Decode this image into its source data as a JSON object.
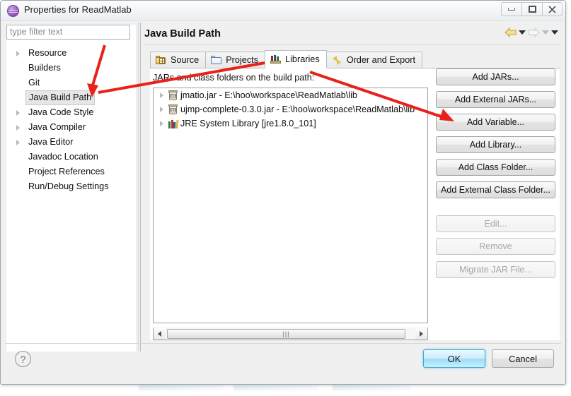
{
  "window": {
    "title": "Properties for ReadMatlab",
    "icon": "eclipse-properties-icon",
    "controls": {
      "minimize": "Minimize",
      "maximize": "Maximize",
      "close": "Close"
    }
  },
  "filter": {
    "placeholder": "type filter text",
    "value": ""
  },
  "sidebar": {
    "items": [
      {
        "label": "Resource",
        "expandable": true,
        "selected": false
      },
      {
        "label": "Builders",
        "expandable": false,
        "selected": false
      },
      {
        "label": "Git",
        "expandable": false,
        "selected": false
      },
      {
        "label": "Java Build Path",
        "expandable": false,
        "selected": true
      },
      {
        "label": "Java Code Style",
        "expandable": true,
        "selected": false
      },
      {
        "label": "Java Compiler",
        "expandable": true,
        "selected": false
      },
      {
        "label": "Java Editor",
        "expandable": true,
        "selected": false
      },
      {
        "label": "Javadoc Location",
        "expandable": false,
        "selected": false
      },
      {
        "label": "Project References",
        "expandable": false,
        "selected": false
      },
      {
        "label": "Run/Debug Settings",
        "expandable": false,
        "selected": false
      }
    ]
  },
  "main": {
    "title": "Java Build Path",
    "nav": {
      "back_icon": "back-arrow-icon",
      "back_menu_icon": "chevron-down-icon",
      "forward_icon": "forward-arrow-icon",
      "forward_menu_icon": "chevron-down-icon",
      "view_menu_icon": "chevron-down-icon"
    },
    "tabs": [
      {
        "label": "Source",
        "icon": "source-folder-icon",
        "active": false
      },
      {
        "label": "Projects",
        "icon": "projects-folder-icon",
        "active": false
      },
      {
        "label": "Libraries",
        "icon": "libraries-books-icon",
        "active": true
      },
      {
        "label": "Order and Export",
        "icon": "order-export-arrows-icon",
        "active": false
      }
    ],
    "list_label": "JARs and class folders on the build path:",
    "entries": [
      {
        "label": "jmatio.jar - E:\\hoo\\workspace\\ReadMatlab\\lib",
        "icon": "jar-icon",
        "expandable": true
      },
      {
        "label": "ujmp-complete-0.3.0.jar - E:\\hoo\\workspace\\ReadMatlab\\lib",
        "icon": "jar-icon",
        "expandable": true
      },
      {
        "label": "JRE System Library [jre1.8.0_101]",
        "icon": "jre-library-icon",
        "expandable": true
      }
    ],
    "scrollbar": {
      "left_arrow_icon": "scroll-left-icon",
      "right_arrow_icon": "scroll-right-icon",
      "grip": "|||"
    },
    "buttons": [
      {
        "label": "Add JARs...",
        "enabled": true
      },
      {
        "label": "Add External JARs...",
        "enabled": true
      },
      {
        "label": "Add Variable...",
        "enabled": true
      },
      {
        "label": "Add Library...",
        "enabled": true
      },
      {
        "label": "Add Class Folder...",
        "enabled": true
      },
      {
        "label": "Add External Class Folder...",
        "enabled": true
      },
      {
        "label": "Edit...",
        "enabled": false
      },
      {
        "label": "Remove",
        "enabled": false
      },
      {
        "label": "Migrate JAR File...",
        "enabled": false
      }
    ]
  },
  "footer": {
    "help_icon": "help-question-icon",
    "ok_label": "OK",
    "cancel_label": "Cancel"
  },
  "annotations": {
    "color": "#e8221a",
    "arrows": [
      {
        "name": "arrow-to-java-build-path",
        "target": "Java Build Path"
      },
      {
        "name": "arrow-to-libraries-tab",
        "target": "Libraries"
      },
      {
        "name": "arrow-to-add-external-jars",
        "target": "Add External JARs..."
      }
    ]
  }
}
